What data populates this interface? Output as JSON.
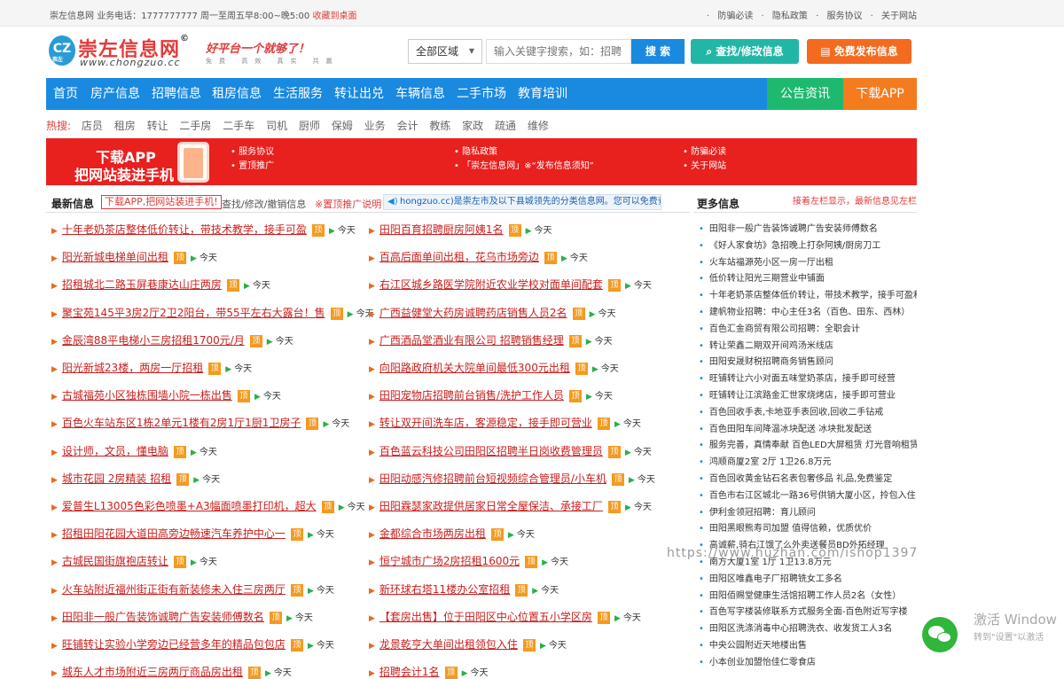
{
  "topbar": {
    "site_name": "崇左信息网",
    "phone": "业务电话：1777777777 周一至周五早8:00~晚5:00",
    "favorite": "收藏到桌面",
    "links": [
      "防骗必读",
      "隐私政策",
      "服务协议",
      "关于网站"
    ]
  },
  "header": {
    "logo_badge": "CZ",
    "logo_badge_sub": "崇左",
    "logo_title": "崇左信息网",
    "logo_mark": "©",
    "logo_url": "www.chongzuo.cc",
    "slogan": "好平台一个就够了！",
    "slogan_sub": "免费 高效 真实 共赢",
    "region_select": "全部区域",
    "search_placeholder": "输入关键字搜索，如：招聘",
    "search_button": "搜 索",
    "find_button": "查找/修改信息",
    "post_button": "免费发布信息"
  },
  "nav": {
    "items": [
      "首页",
      "房产信息",
      "招聘信息",
      "租房信息",
      "生活服务",
      "转让出兑",
      "车辆信息",
      "二手市场",
      "教育培训"
    ],
    "notice": "公告资讯",
    "download": "下载APP"
  },
  "hot": {
    "label": "热搜:",
    "keywords": [
      "店员",
      "租房",
      "转让",
      "二手房",
      "二手车",
      "司机",
      "厨师",
      "保姆",
      "业务",
      "会计",
      "教练",
      "家政",
      "疏通",
      "维修"
    ]
  },
  "banner": {
    "line1": "下载APP",
    "line2": "把网站装进手机",
    "links": [
      "服务协议",
      "置顶推广",
      "隐私政策",
      "「崇左信息网」※“发布信息须知”",
      "防骗必读",
      "关于网站"
    ]
  },
  "latest": {
    "title": "最新信息",
    "tag": "下载APP,把网站装进手机!",
    "link_find": "查找/修改/撤销信息",
    "link_top": "※置顶推广说明",
    "notice": "hongzuo.cc)是崇左市及以下县城领先的分类信息网。您可以免费查",
    "ding": "顶",
    "date": "今天",
    "left": [
      "十年老奶茶店整体低价转让，带技术教学，接手可盈",
      "阳光新城电梯单间出租",
      "招租城北二路玉屏巷康达山庄两房",
      "聚宝苑145平3房2厅2卫2阳台，带55平左右大露台！售",
      "金辰湾88平电梯小三房招租1700元/月",
      "阳光新城23楼，两房一厅招租",
      "古城福苑小区独栋围墙小院一栋出售",
      "百色火车站东区1栋2单元1楼有2房1厅1厨1卫房子",
      "设计师，文员，懂电脑",
      "城市花园 2房精装 招租",
      "爱普生L13005色彩色喷墨+A3幅面喷墨打印机，超大",
      "招租田阳花园大道田高旁边畅速汽车养护中心一",
      "古城民国街旗袍店转让",
      "火车站附近福州街正街有新装修未入住三房两厅",
      "田阳非一般广告装饰诚聘广告安装师傅数名",
      "旺铺转让实验小学旁边已经营多年的精品包包店",
      "城东人才市场附近三房两厅商品房出租"
    ],
    "right": [
      "田阳百育招聘厨房阿姨1名",
      "百高后面单间出租，花乌市场旁边",
      "右江区城乡路医学院附近农业学校对面单间配套",
      "广西益健堂大药房诚聘药店销售人员2名",
      "广西酒品堂酒业有限公司 招聘销售经理",
      "向阳路政府机关大院单间最低300元出租",
      "田阳宠物店招聘前台销售/洗护工作人员",
      "转让双开间洗车店，客源稳定，接手即可营业",
      "百色蓝云科技公司田阳区招聘半日岗收费管理员",
      "田阳动感汽修招聘前台短视频综合管理员/小车机",
      "田阳霖瑟家政提供居家日常全屋保洁、承接工厂",
      "金都综合市场两房出租",
      "恒宁城市广场2房招租1600元",
      "新环球右塔11楼办公室招租",
      "【套房出售】位于田阳区中心位置五小学区房",
      "龙景乾亨大单间出租领包入住",
      "招聘会计1名"
    ]
  },
  "more": {
    "title": "更多信息",
    "hint": "接着左栏显示，最新信息见左栏",
    "items": [
      "田阳非一般广告装饰诚聘广告安装师傅数名",
      "《好人家食坊》急招晚上打杂阿姨/厨房刀工",
      "火车站福源苑小区一房一厅出租",
      "低价转让阳光三期营业中铺面",
      "十年老奶茶店整体低价转让，带技术教学，接手可盈利",
      "建帆物业招聘：中心主任3名（百色、田东、西林）",
      "百色汇金商贸有限公司招聘：全职会计",
      "转让荣鑫二期双开间鸡汤米线店",
      "田阳安晟财税招聘商务销售顾问",
      "旺铺转让六小对面五味堂奶茶店，接手即可经营",
      "旺铺转让江滨路金汇世家烧烤店，接手即可营业",
      "百色回收手表,卡地亚手表回收,回收二手钻戒",
      "百色田阳车间降温冰块配送 冰块批发配送",
      "服务完善，真情奉献 百色LED大屏租赁 灯光音响租赁",
      "鸿顺商厦2室 2厅 1卫26.8万元",
      "百色回收黄金钻石名表包奢侈品 礼品,免费鉴定",
      "百色市右江区城北一路36号供销大厦小区，拎包入住",
      "伊利金领冠招聘：育儿顾问",
      "田阳黑眼熊寿司加盟 值得信赖，优质优价",
      "高诚薪,骑右江饿了么外卖送餐员BD外拓经理",
      "南方大厦1室 1厅 1卫13.8万元",
      "田阳区唯鑫电子厂招聘铣女工多名",
      "田阳佰赐堂健康生活馆招聘工作人员2名（女性）",
      "百色写字楼装修联系方式服务全面-百色附近写字楼",
      "田阳区洗涤消毒中心招聘洗衣、收发货工人3名",
      "中央公园附近天地楼出售",
      "小本创业加盟怡佳仁零食店"
    ]
  },
  "overlay": {
    "watermark": "https://www.huzhan.com/ishop1397",
    "activate_title": "激活 Window",
    "activate_sub": "转到\"设置\"以激活"
  },
  "colors": {
    "brand_blue": "#1a89e0",
    "brand_red": "#e23b3b",
    "teal": "#22b6a6",
    "orange": "#f46a1e",
    "green": "#1fb86f"
  }
}
